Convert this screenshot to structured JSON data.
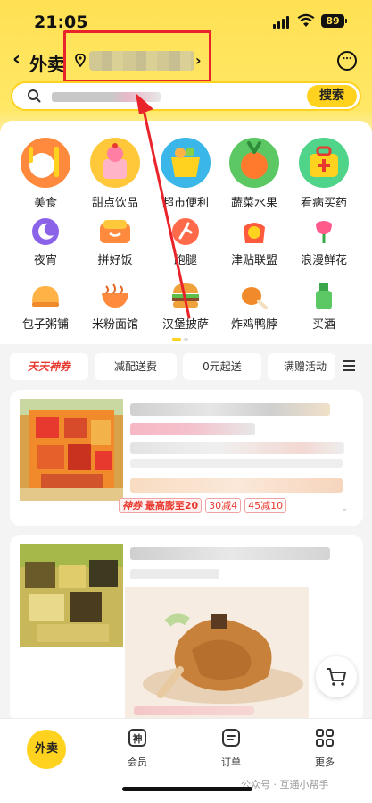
{
  "status_bar": {
    "time": "21:05",
    "battery": "89"
  },
  "header": {
    "back_icon": "chevron-left-icon",
    "title": "外卖",
    "location_chevron": "›",
    "message_icon_glyph": "⋯"
  },
  "search": {
    "button_label": "搜索"
  },
  "categories": [
    {
      "label": "美食",
      "icon": "food-icon"
    },
    {
      "label": "甜点饮品",
      "icon": "dessert-icon"
    },
    {
      "label": "超市便利",
      "icon": "supermarket-icon"
    },
    {
      "label": "蔬菜水果",
      "icon": "vegetable-icon"
    },
    {
      "label": "看病买药",
      "icon": "medicine-icon"
    },
    {
      "label": "夜宵",
      "icon": "night-snack-icon"
    },
    {
      "label": "拼好饭",
      "icon": "group-meal-icon"
    },
    {
      "label": "跑腿",
      "icon": "errand-icon"
    },
    {
      "label": "津贴联盟",
      "icon": "subsidy-icon"
    },
    {
      "label": "浪漫鲜花",
      "icon": "flower-icon"
    },
    {
      "label": "包子粥铺",
      "icon": "bun-icon"
    },
    {
      "label": "米粉面馆",
      "icon": "noodle-icon"
    },
    {
      "label": "汉堡披萨",
      "icon": "burger-icon"
    },
    {
      "label": "炸鸡鸭脖",
      "icon": "fried-chicken-icon"
    },
    {
      "label": "买酒",
      "icon": "liquor-icon"
    }
  ],
  "filters": {
    "chips": [
      "天天神券",
      "减配送费",
      "0元起送",
      "满赠活动"
    ],
    "menu_icon": "menu-icon"
  },
  "card1": {
    "coupon_brand": "神券",
    "coupon_text": "最高膨至20",
    "discount_1": "30减4",
    "discount_2": "45减10"
  },
  "bottom_tabs": [
    {
      "label": "外卖",
      "icon": "takeout-icon"
    },
    {
      "label": "会员",
      "icon": "member-icon"
    },
    {
      "label": "订单",
      "icon": "order-icon"
    },
    {
      "label": "更多",
      "icon": "grid-icon"
    }
  ],
  "watermark": "公众号 · 互通小帮手",
  "colors": {
    "brand_yellow": "#ffd21f",
    "annotation_red": "#e8242a",
    "discount_red": "#e8392f"
  }
}
